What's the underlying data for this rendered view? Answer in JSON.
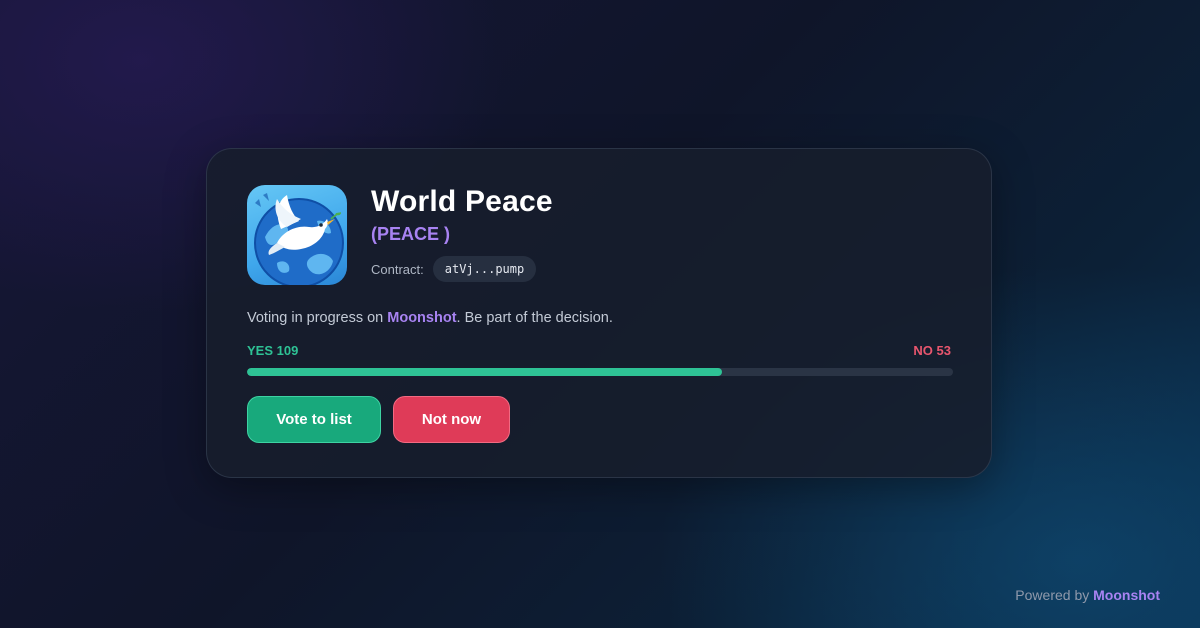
{
  "token": {
    "name": "World Peace",
    "ticker": "(PEACE )",
    "contract_label": "Contract:",
    "contract_address": "atVj...pump",
    "logo_icon": "dove-globe-logo"
  },
  "voting": {
    "description_prefix": "Voting in progress on ",
    "platform": "Moonshot",
    "description_suffix": ". Be part of the decision.",
    "yes_label": "YES 109",
    "no_label": "NO 53",
    "yes_count": 109,
    "no_count": 53
  },
  "actions": {
    "vote_label": "Vote to list",
    "decline_label": "Not now"
  },
  "footer": {
    "prefix": "Powered by ",
    "brand": "Moonshot"
  },
  "colors": {
    "accent_purple": "#a883f2",
    "yes_green": "#2ec295",
    "no_red": "#e9566e",
    "vote_button": "#18a97c",
    "decline_button": "#df3b58"
  }
}
